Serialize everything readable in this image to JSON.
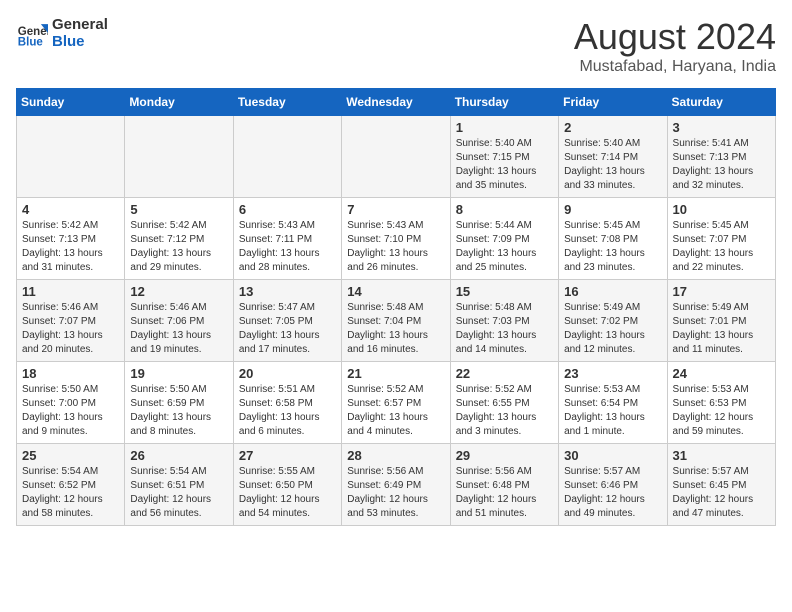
{
  "header": {
    "logo_line1": "General",
    "logo_line2": "Blue",
    "month_year": "August 2024",
    "location": "Mustafabad, Haryana, India"
  },
  "days_of_week": [
    "Sunday",
    "Monday",
    "Tuesday",
    "Wednesday",
    "Thursday",
    "Friday",
    "Saturday"
  ],
  "weeks": [
    [
      {
        "day": "",
        "info": ""
      },
      {
        "day": "",
        "info": ""
      },
      {
        "day": "",
        "info": ""
      },
      {
        "day": "",
        "info": ""
      },
      {
        "day": "1",
        "info": "Sunrise: 5:40 AM\nSunset: 7:15 PM\nDaylight: 13 hours\nand 35 minutes."
      },
      {
        "day": "2",
        "info": "Sunrise: 5:40 AM\nSunset: 7:14 PM\nDaylight: 13 hours\nand 33 minutes."
      },
      {
        "day": "3",
        "info": "Sunrise: 5:41 AM\nSunset: 7:13 PM\nDaylight: 13 hours\nand 32 minutes."
      }
    ],
    [
      {
        "day": "4",
        "info": "Sunrise: 5:42 AM\nSunset: 7:13 PM\nDaylight: 13 hours\nand 31 minutes."
      },
      {
        "day": "5",
        "info": "Sunrise: 5:42 AM\nSunset: 7:12 PM\nDaylight: 13 hours\nand 29 minutes."
      },
      {
        "day": "6",
        "info": "Sunrise: 5:43 AM\nSunset: 7:11 PM\nDaylight: 13 hours\nand 28 minutes."
      },
      {
        "day": "7",
        "info": "Sunrise: 5:43 AM\nSunset: 7:10 PM\nDaylight: 13 hours\nand 26 minutes."
      },
      {
        "day": "8",
        "info": "Sunrise: 5:44 AM\nSunset: 7:09 PM\nDaylight: 13 hours\nand 25 minutes."
      },
      {
        "day": "9",
        "info": "Sunrise: 5:45 AM\nSunset: 7:08 PM\nDaylight: 13 hours\nand 23 minutes."
      },
      {
        "day": "10",
        "info": "Sunrise: 5:45 AM\nSunset: 7:07 PM\nDaylight: 13 hours\nand 22 minutes."
      }
    ],
    [
      {
        "day": "11",
        "info": "Sunrise: 5:46 AM\nSunset: 7:07 PM\nDaylight: 13 hours\nand 20 minutes."
      },
      {
        "day": "12",
        "info": "Sunrise: 5:46 AM\nSunset: 7:06 PM\nDaylight: 13 hours\nand 19 minutes."
      },
      {
        "day": "13",
        "info": "Sunrise: 5:47 AM\nSunset: 7:05 PM\nDaylight: 13 hours\nand 17 minutes."
      },
      {
        "day": "14",
        "info": "Sunrise: 5:48 AM\nSunset: 7:04 PM\nDaylight: 13 hours\nand 16 minutes."
      },
      {
        "day": "15",
        "info": "Sunrise: 5:48 AM\nSunset: 7:03 PM\nDaylight: 13 hours\nand 14 minutes."
      },
      {
        "day": "16",
        "info": "Sunrise: 5:49 AM\nSunset: 7:02 PM\nDaylight: 13 hours\nand 12 minutes."
      },
      {
        "day": "17",
        "info": "Sunrise: 5:49 AM\nSunset: 7:01 PM\nDaylight: 13 hours\nand 11 minutes."
      }
    ],
    [
      {
        "day": "18",
        "info": "Sunrise: 5:50 AM\nSunset: 7:00 PM\nDaylight: 13 hours\nand 9 minutes."
      },
      {
        "day": "19",
        "info": "Sunrise: 5:50 AM\nSunset: 6:59 PM\nDaylight: 13 hours\nand 8 minutes."
      },
      {
        "day": "20",
        "info": "Sunrise: 5:51 AM\nSunset: 6:58 PM\nDaylight: 13 hours\nand 6 minutes."
      },
      {
        "day": "21",
        "info": "Sunrise: 5:52 AM\nSunset: 6:57 PM\nDaylight: 13 hours\nand 4 minutes."
      },
      {
        "day": "22",
        "info": "Sunrise: 5:52 AM\nSunset: 6:55 PM\nDaylight: 13 hours\nand 3 minutes."
      },
      {
        "day": "23",
        "info": "Sunrise: 5:53 AM\nSunset: 6:54 PM\nDaylight: 13 hours\nand 1 minute."
      },
      {
        "day": "24",
        "info": "Sunrise: 5:53 AM\nSunset: 6:53 PM\nDaylight: 12 hours\nand 59 minutes."
      }
    ],
    [
      {
        "day": "25",
        "info": "Sunrise: 5:54 AM\nSunset: 6:52 PM\nDaylight: 12 hours\nand 58 minutes."
      },
      {
        "day": "26",
        "info": "Sunrise: 5:54 AM\nSunset: 6:51 PM\nDaylight: 12 hours\nand 56 minutes."
      },
      {
        "day": "27",
        "info": "Sunrise: 5:55 AM\nSunset: 6:50 PM\nDaylight: 12 hours\nand 54 minutes."
      },
      {
        "day": "28",
        "info": "Sunrise: 5:56 AM\nSunset: 6:49 PM\nDaylight: 12 hours\nand 53 minutes."
      },
      {
        "day": "29",
        "info": "Sunrise: 5:56 AM\nSunset: 6:48 PM\nDaylight: 12 hours\nand 51 minutes."
      },
      {
        "day": "30",
        "info": "Sunrise: 5:57 AM\nSunset: 6:46 PM\nDaylight: 12 hours\nand 49 minutes."
      },
      {
        "day": "31",
        "info": "Sunrise: 5:57 AM\nSunset: 6:45 PM\nDaylight: 12 hours\nand 47 minutes."
      }
    ]
  ]
}
